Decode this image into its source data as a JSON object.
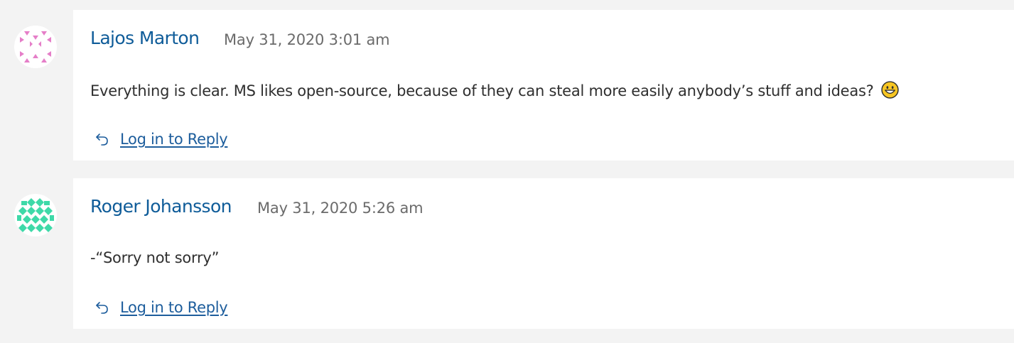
{
  "comments": [
    {
      "author": "Lajos Marton",
      "date": "May 31, 2020 3:01 am",
      "text": "Everything is clear. MS likes open-source, because of they can steal more easily anybody’s stuff and ideas?",
      "has_emoji": true,
      "emoji_icon": "grinning-face-icon",
      "avatar_color": "#e57ec8",
      "reply_label": "Log in to Reply"
    },
    {
      "author": "Roger Johansson",
      "date": "May 31, 2020 5:26 am",
      "text": "-“Sorry not sorry”",
      "has_emoji": false,
      "avatar_color": "#3ed9a8",
      "reply_label": "Log in to Reply"
    }
  ],
  "colors": {
    "background": "#f3f3f3",
    "card": "#ffffff",
    "author": "#0f5c99",
    "date": "#6b6b6b",
    "link": "#1d5d9c"
  }
}
